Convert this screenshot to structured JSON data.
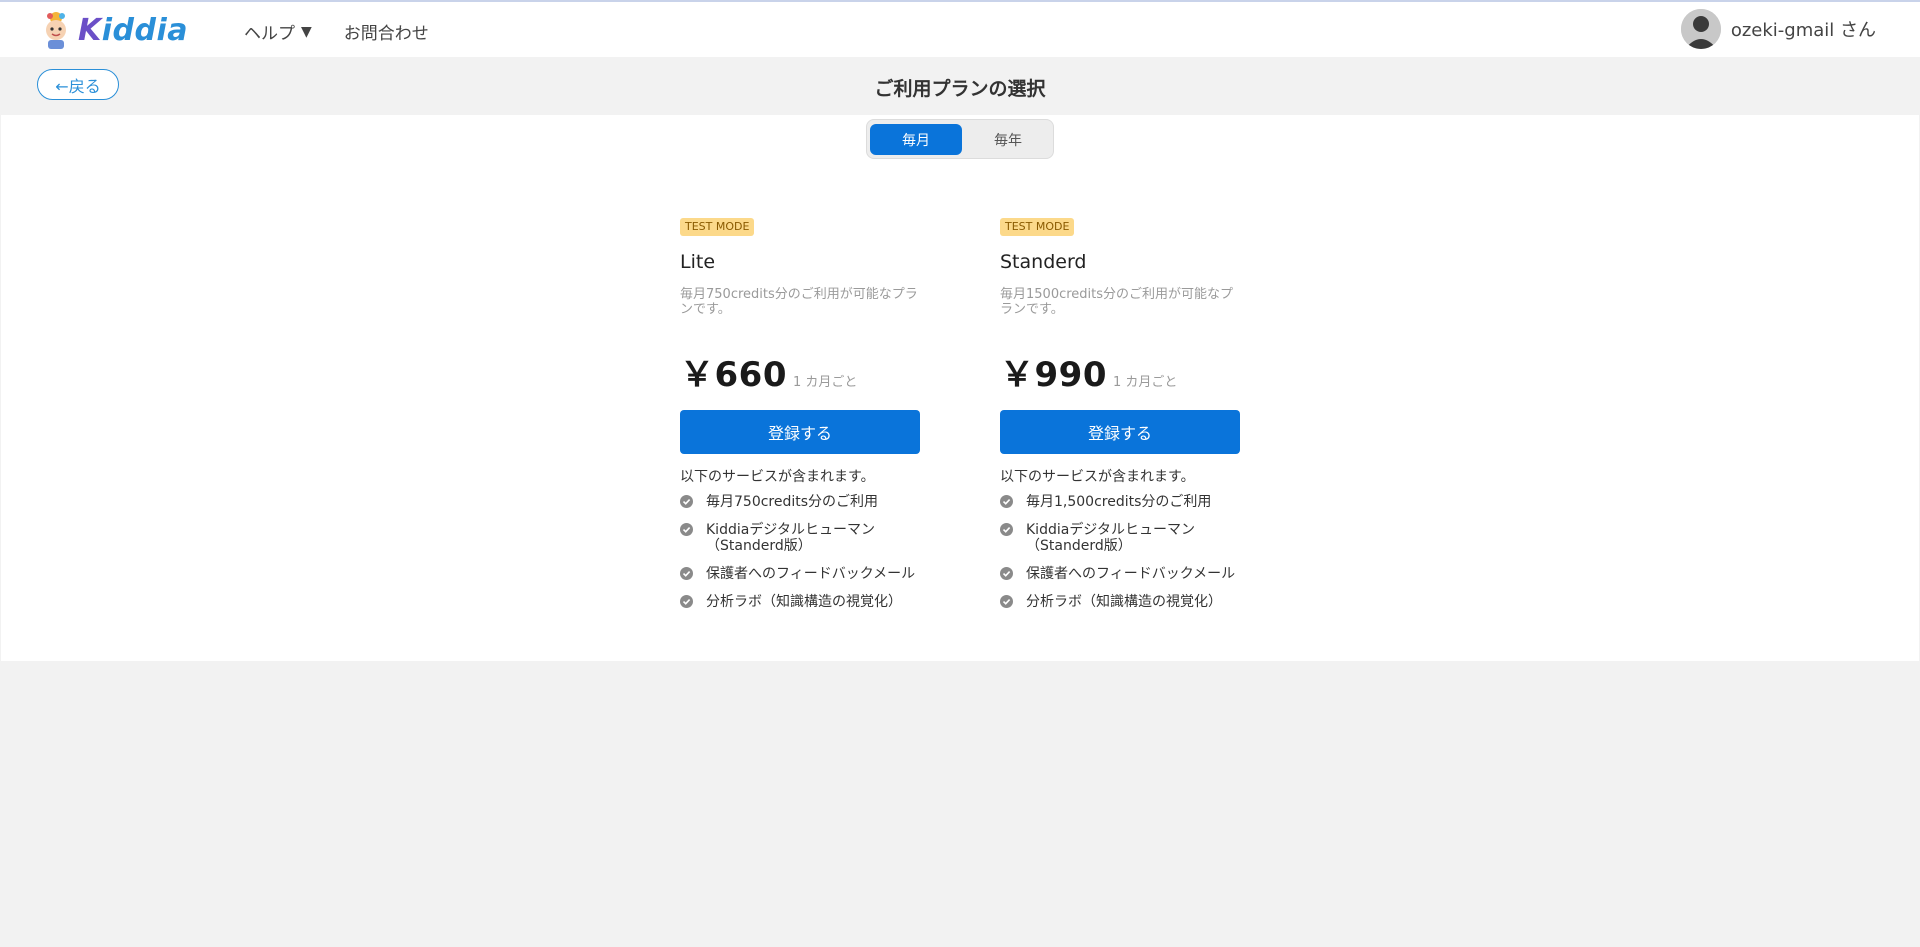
{
  "app": {
    "logo_text_k": "K",
    "logo_text_rest": "iddia"
  },
  "nav": {
    "help": "ヘルプ",
    "help_caret": "▼",
    "contact": "お問合わせ"
  },
  "user": {
    "name": "ozeki-gmail さん"
  },
  "subbar": {
    "back": "←戻る",
    "title": "ご利用プランの選択"
  },
  "billing_toggle": {
    "monthly": "毎月",
    "yearly": "毎年",
    "selected": "毎月"
  },
  "plans": [
    {
      "badge": "TEST MODE",
      "name": "Lite",
      "description": "毎月750credits分のご利用が可能なプランです。",
      "price": "￥660",
      "per": "1 カ月ごと",
      "cta": "登録する",
      "includes": "以下のサービスが含まれます。",
      "features": [
        "毎月750credits分のご利用",
        "Kiddiaデジタルヒューマン（Standerd版）",
        "保護者へのフィードバックメール",
        "分析ラボ（知識構造の視覚化）"
      ]
    },
    {
      "badge": "TEST MODE",
      "name": "Standerd",
      "description": "毎月1500credits分のご利用が可能なプランです。",
      "price": "￥990",
      "per": "1 カ月ごと",
      "cta": "登録する",
      "includes": "以下のサービスが含まれます。",
      "features": [
        "毎月1,500credits分のご利用",
        "Kiddiaデジタルヒューマン（Standerd版）",
        "保護者へのフィードバックメール",
        "分析ラボ（知識構造の視覚化）"
      ]
    }
  ],
  "colors": {
    "primary": "#0a74da",
    "badge_bg": "#fcd98a",
    "page_bg": "#f2f2f2"
  },
  "icons": {
    "check": "check-circle-icon",
    "avatar": "user-avatar-icon"
  }
}
